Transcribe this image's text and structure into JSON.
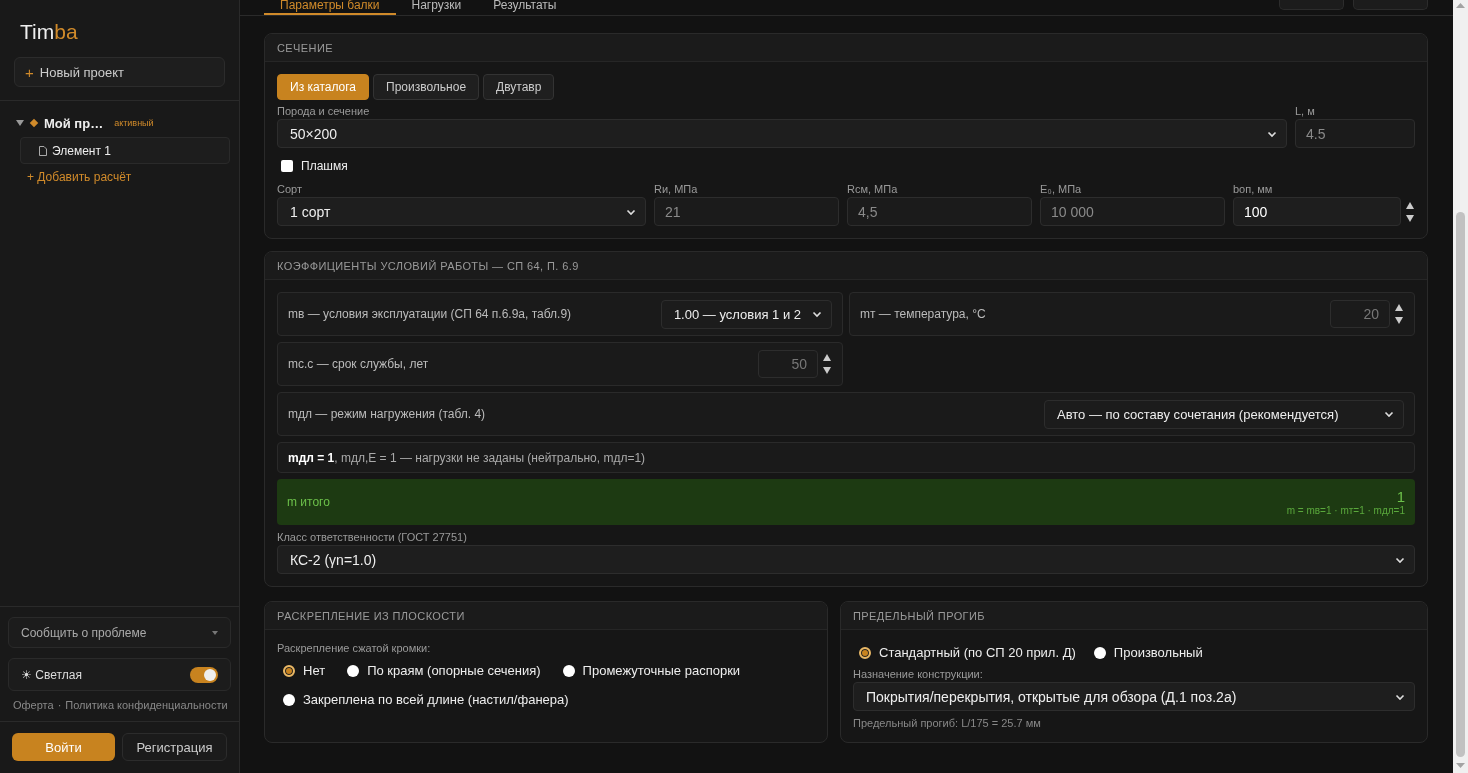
{
  "app": {
    "logo_main": "Tim",
    "logo_accent": "ba"
  },
  "sidebar": {
    "new_project": {
      "icon": "+",
      "label": "Новый проект"
    },
    "projects": [
      {
        "name": "Мой пр…",
        "badge": "активный",
        "expanded": true,
        "children": [
          {
            "name": "Элемент 1",
            "selected": true
          }
        ],
        "add_label": "+ Добавить расчёт"
      }
    ],
    "report": {
      "label": "Сообщить о проблеме"
    },
    "theme": {
      "icon": "☀",
      "label": "Светлая",
      "on": true
    },
    "links": [
      "Оферта",
      "Политика конфиденциальности"
    ],
    "link_separator": "·",
    "login": "Войти",
    "register": "Регистрация"
  },
  "tabs": [
    {
      "label": "Параметры балки",
      "selected": true
    },
    {
      "label": "Нагрузки",
      "selected": false
    },
    {
      "label": "Результаты",
      "selected": false
    }
  ],
  "section": {
    "title": "СЕЧЕНИЕ",
    "modes": [
      {
        "label": "Из каталога",
        "selected": true
      },
      {
        "label": "Произвольное",
        "selected": false
      },
      {
        "label": "Двутавр",
        "selected": false
      }
    ],
    "species": {
      "label": "Порода и сечение",
      "value": "50×200"
    },
    "length": {
      "label": "L, м",
      "value": "4.5",
      "disabled": true
    },
    "flat": {
      "label": "Плашмя",
      "checked": false
    },
    "fields": [
      {
        "kind": "select",
        "label": "Сорт",
        "value": "1 сорт"
      },
      {
        "kind": "readonly",
        "label": "Rи, МПа",
        "value": "21",
        "disabled": true
      },
      {
        "kind": "readonly",
        "label": "Rсм, МПа",
        "value": "4,5",
        "disabled": true
      },
      {
        "kind": "readonly",
        "label": "E₀, МПа",
        "value": "10 000",
        "disabled": true
      },
      {
        "kind": "spin",
        "label": "bоп, мм",
        "value": "100",
        "disabled": false
      }
    ]
  },
  "coefficients": {
    "title": "КОЭФФИЦИЕНТЫ УСЛОВИЙ РАБОТЫ — СП 64, П. 6.9",
    "rows": [
      {
        "kind": "select",
        "label": "mв — условия эксплуатации (СП 64 п.6.9а, табл.9)",
        "value": "1.00 — условия 1 и 2"
      },
      {
        "kind": "spin",
        "label": "mт — температура, °C",
        "value": "20",
        "disabled": true
      },
      {
        "kind": "spin",
        "label": "mс.с — срок службы, лет",
        "value": "50",
        "disabled": true
      },
      {
        "kind": "wide-select",
        "label": "mдл — режим нагружения (табл. 4)",
        "value": "Авто — по составу сочетания (рекомендуется)"
      }
    ],
    "info": "**mдл = 1**, mдл,E = 1 — нагрузки не заданы (нейтрально, mдл=1)",
    "total": {
      "label": "m итого",
      "value": "1",
      "formula": "m = mв=1 · mт=1 · mдл=1"
    },
    "responsibility": {
      "label": "Класс ответственности (ГОСТ 27751)",
      "value": "КС-2 (γn=1.0)"
    }
  },
  "bracing": {
    "title": "РАСКРЕПЛЕНИЕ ИЗ ПЛОСКОСТИ",
    "label": "Раскрепление сжатой кромки:",
    "options": [
      {
        "label": "Нет",
        "selected": true
      },
      {
        "label": "По краям (опорные сечения)",
        "selected": false
      },
      {
        "label": "Промежуточные распорки",
        "selected": false
      },
      {
        "label": "Закреплена по всей длине (настил/фанера)",
        "selected": false
      }
    ]
  },
  "deflection": {
    "title": "ПРЕДЕЛЬНЫЙ ПРОГИБ",
    "options": [
      {
        "label": "Стандартный (по СП 20 прил. Д)",
        "selected": true
      },
      {
        "label": "Произвольный",
        "selected": false
      }
    ],
    "purpose": {
      "label": "Назначение конструкции:",
      "value": "Покрытия/перекрытия, открытые для обзора (Д.1 поз.2а)"
    },
    "note": "Предельный прогиб: L/175 = 25.7 мм"
  }
}
